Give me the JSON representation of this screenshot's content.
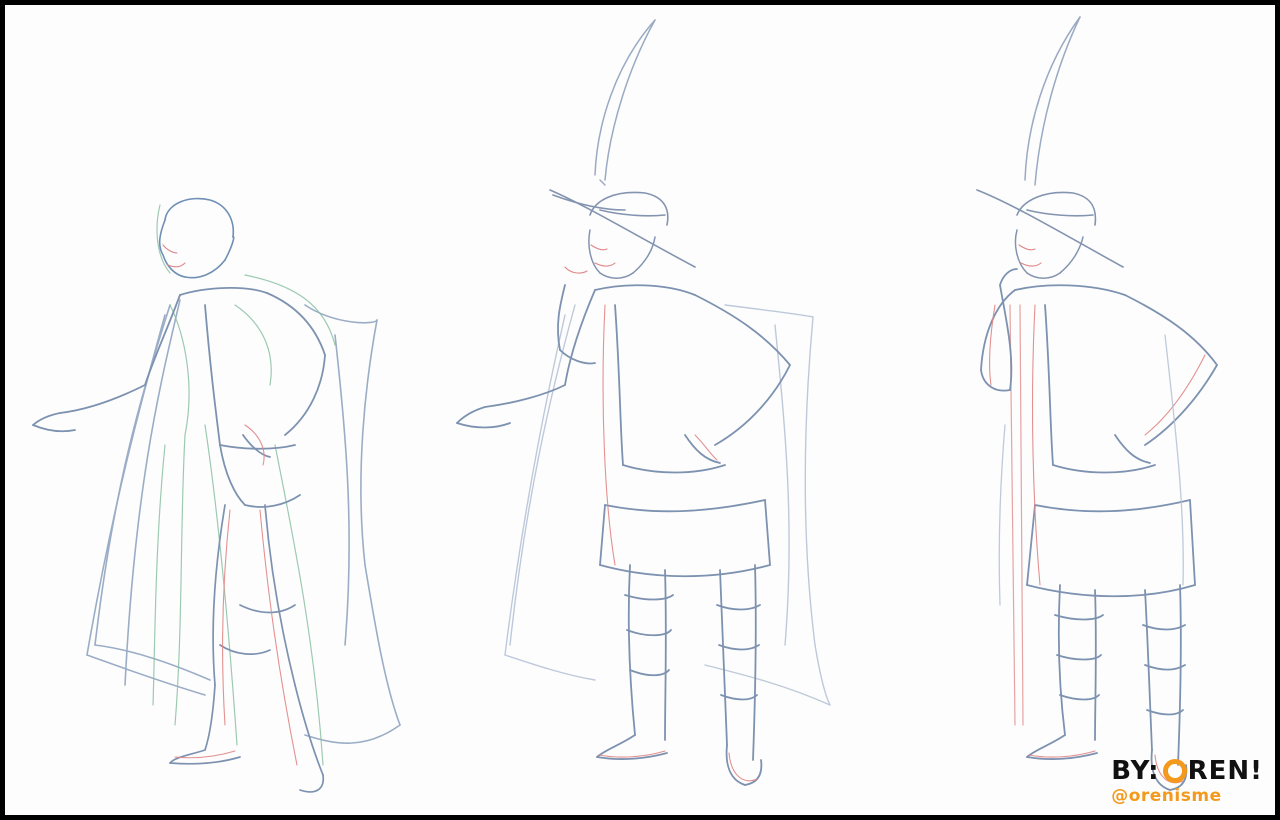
{
  "artwork": {
    "panels": [
      {
        "name": "figure-1",
        "hat": false,
        "sword": false
      },
      {
        "name": "figure-2",
        "hat": true,
        "sword": true
      },
      {
        "name": "figure-3",
        "hat": true,
        "sword": true
      }
    ],
    "colors": {
      "background": "#fdfdfd",
      "frame": "#000000",
      "stroke_blue": "#7d92b0",
      "stroke_blue_light": "#a9b8cf",
      "stroke_red": "#e08585",
      "stroke_green": "#7fb79a",
      "accent_orange": "#f39a1c"
    }
  },
  "signature": {
    "prefix": "BY:",
    "name_rest": "REN!",
    "handle": "@orenisme"
  }
}
